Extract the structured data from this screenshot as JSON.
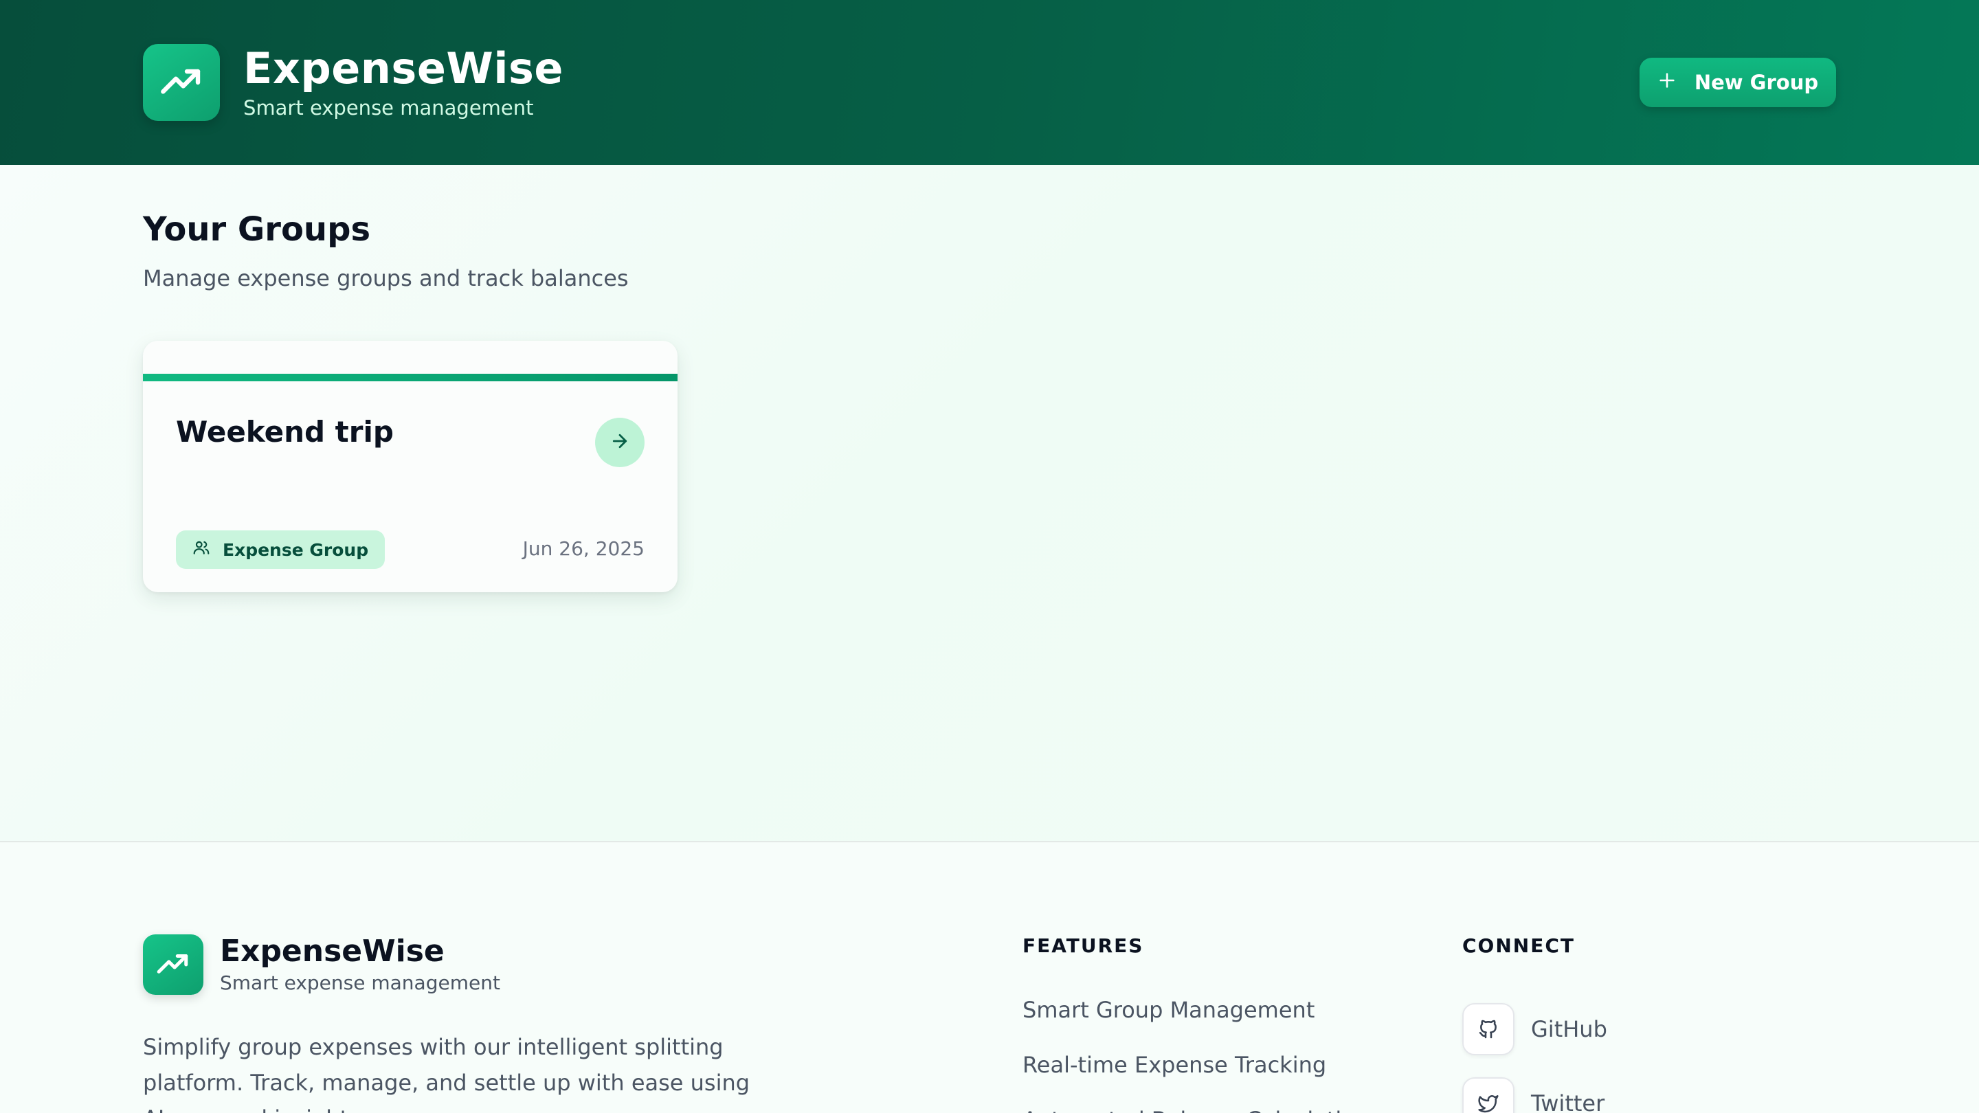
{
  "header": {
    "app_name": "ExpenseWise",
    "tagline": "Smart expense management",
    "logo_icon": "trending-up-icon",
    "new_group_label": "New Group",
    "new_group_icon": "plus-icon"
  },
  "main": {
    "title": "Your Groups",
    "subtitle": "Manage expense groups and track balances",
    "groups": [
      {
        "name": "Weekend trip",
        "badge": "Expense Group",
        "badge_icon": "users-icon",
        "date": "Jun 26, 2025",
        "open_icon": "arrow-right-icon"
      }
    ]
  },
  "footer": {
    "app_name": "ExpenseWise",
    "tagline": "Smart expense management",
    "description": "Simplify group expenses with our intelligent splitting platform. Track, manage, and settle up with ease using AI-powered insights.",
    "features_heading": "FEATURES",
    "features": [
      "Smart Group Management",
      "Real-time Expense Tracking",
      "Automated Balance Calculation"
    ],
    "connect_heading": "CONNECT",
    "links": [
      {
        "label": "GitHub",
        "icon": "github-icon"
      },
      {
        "label": "Twitter",
        "icon": "twitter-icon"
      }
    ]
  },
  "colors": {
    "header_dark": "#064e3b",
    "accent": "#10b981",
    "badge_bg": "#c9f5dd",
    "text_dark": "#0b1220",
    "text_muted": "#4b5563"
  }
}
